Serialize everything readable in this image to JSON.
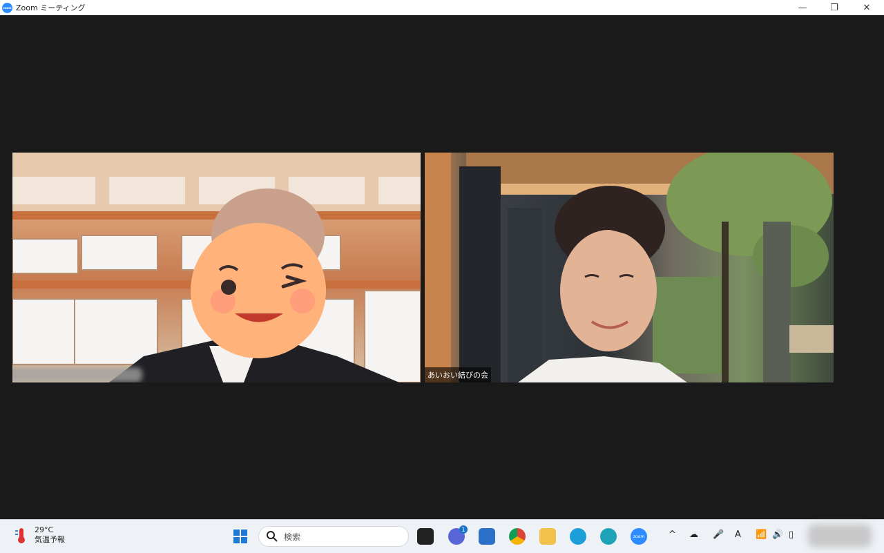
{
  "window": {
    "title": "Zoom ミーティング",
    "logo_text": "zoom",
    "controls": {
      "minimize": "—",
      "restore": "❐",
      "close": "✕"
    }
  },
  "participants": [
    {
      "name": "",
      "name_blurred": true
    },
    {
      "name": "あいおい結びの会",
      "name_blurred": false
    }
  ],
  "taskbar": {
    "weather": {
      "temp": "29°C",
      "label": "気温予報"
    },
    "search": {
      "placeholder": "検索"
    },
    "chat_badge": "1",
    "zoom_icon_text": "zoom",
    "tray": {
      "ime": "A"
    }
  },
  "colors": {
    "zoom_blue": "#2d8cff",
    "meeting_bg": "#1a1a1a",
    "taskbar_bg": "#eef1f6"
  }
}
